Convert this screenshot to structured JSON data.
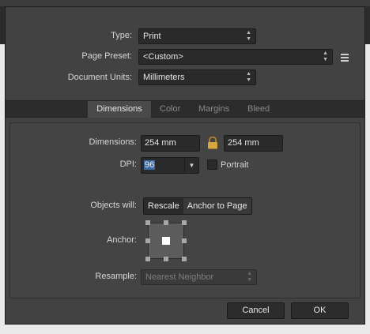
{
  "document": {
    "type_label": "Type:",
    "type_value": "Print",
    "preset_label": "Page Preset:",
    "preset_value": "<Custom>",
    "units_label": "Document Units:",
    "units_value": "Millimeters"
  },
  "tabs": [
    "Dimensions",
    "Color",
    "Margins",
    "Bleed"
  ],
  "active_tab": "Dimensions",
  "dimensions": {
    "label": "Dimensions:",
    "width": "254 mm",
    "height": "254 mm",
    "lock_icon": "lock-icon",
    "dpi_label": "DPI:",
    "dpi_value": "96",
    "portrait_label": "Portrait",
    "portrait_checked": false,
    "objects_label": "Objects will:",
    "objects_options": [
      "Rescale",
      "Anchor to Page"
    ],
    "objects_selected": "Rescale",
    "anchor_label": "Anchor:",
    "anchor_selected": "center",
    "resample_label": "Resample:",
    "resample_value": "Nearest Neighbor"
  },
  "buttons": {
    "cancel": "Cancel",
    "ok": "OK"
  },
  "colors": {
    "dialog_bg": "#424242",
    "field_bg": "#2a2a2a",
    "selection": "#3d6aa5",
    "lock": "#d9a640"
  }
}
